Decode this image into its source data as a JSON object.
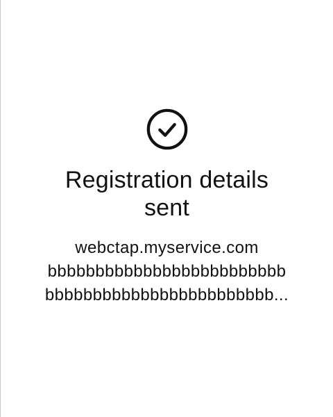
{
  "status": {
    "icon": "check-circle-icon",
    "title": "Registration details sent"
  },
  "details": {
    "host": "webctap.myservice.com",
    "line2": "bbbbbbbbbbbbbbbbbbbbbbbbb",
    "line3": "bbbbbbbbbbbbbbbbbbbbbbbb..."
  },
  "colors": {
    "text": "#111111",
    "background": "#ffffff",
    "edge": "#c8c8c8"
  }
}
